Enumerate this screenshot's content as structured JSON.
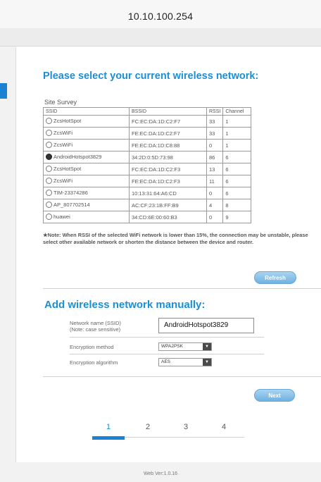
{
  "browser": {
    "url": "10.10.100.254"
  },
  "survey": {
    "heading": "Please select your current wireless network:",
    "label": "Site Survey",
    "columns": [
      "SSID",
      "BSSID",
      "RSSI",
      "Channel"
    ],
    "rows": [
      {
        "ssid": "ZcsHotSpot",
        "bssid": "FC:EC:DA:1D:C2:F7",
        "rssi": "33",
        "channel": "1",
        "selected": false
      },
      {
        "ssid": "ZcsWiFi",
        "bssid": "FE:EC:DA:1D:C2:F7",
        "rssi": "33",
        "channel": "1",
        "selected": false
      },
      {
        "ssid": "ZcsWiFi",
        "bssid": "FE:EC:DA:1D:C8:88",
        "rssi": "0",
        "channel": "1",
        "selected": false
      },
      {
        "ssid": "AndroidHotspot3829",
        "bssid": "34:2D:0:5D:73:98",
        "rssi": "86",
        "channel": "6",
        "selected": true
      },
      {
        "ssid": "ZcsHotSpot",
        "bssid": "FC:EC:DA:1D:C2:F3",
        "rssi": "13",
        "channel": "6",
        "selected": false
      },
      {
        "ssid": "ZcsWiFi",
        "bssid": "FE:EC:DA:1D:C2:F3",
        "rssi": "11",
        "channel": "6",
        "selected": false
      },
      {
        "ssid": "TIM-23374286",
        "bssid": "10:13:31:64:A6:CD",
        "rssi": "0",
        "channel": "6",
        "selected": false
      },
      {
        "ssid": "AP_807702514",
        "bssid": "AC:CF:23:1B:FF:B9",
        "rssi": "4",
        "channel": "8",
        "selected": false
      },
      {
        "ssid": "huawei",
        "bssid": "34:CD:6E:00:60:B3",
        "rssi": "0",
        "channel": "9",
        "selected": false
      }
    ],
    "note": "★Note: When RSSI of the selected WiFi network is lower than 15%, the connection may be unstable, please select other available network or shorten the distance between the device and router.",
    "refresh_label": "Refresh"
  },
  "manual": {
    "heading": "Add wireless network manually:",
    "ssid_label": "Network name (SSID)",
    "ssid_note": "(Note: case sensitive)",
    "ssid_value": "AndroidHotspot3829",
    "encryption_method_label": "Encryption method",
    "encryption_method_value": "WPA2PSK",
    "encryption_algorithm_label": "Encryption algorithm",
    "encryption_algorithm_value": "AES",
    "next_label": "Next"
  },
  "steps": [
    "1",
    "2",
    "3",
    "4"
  ],
  "footer": {
    "version": "Web Ver:1.0.16"
  },
  "colors": {
    "accent": "#1a8fd8",
    "button": "#7db9e4"
  }
}
